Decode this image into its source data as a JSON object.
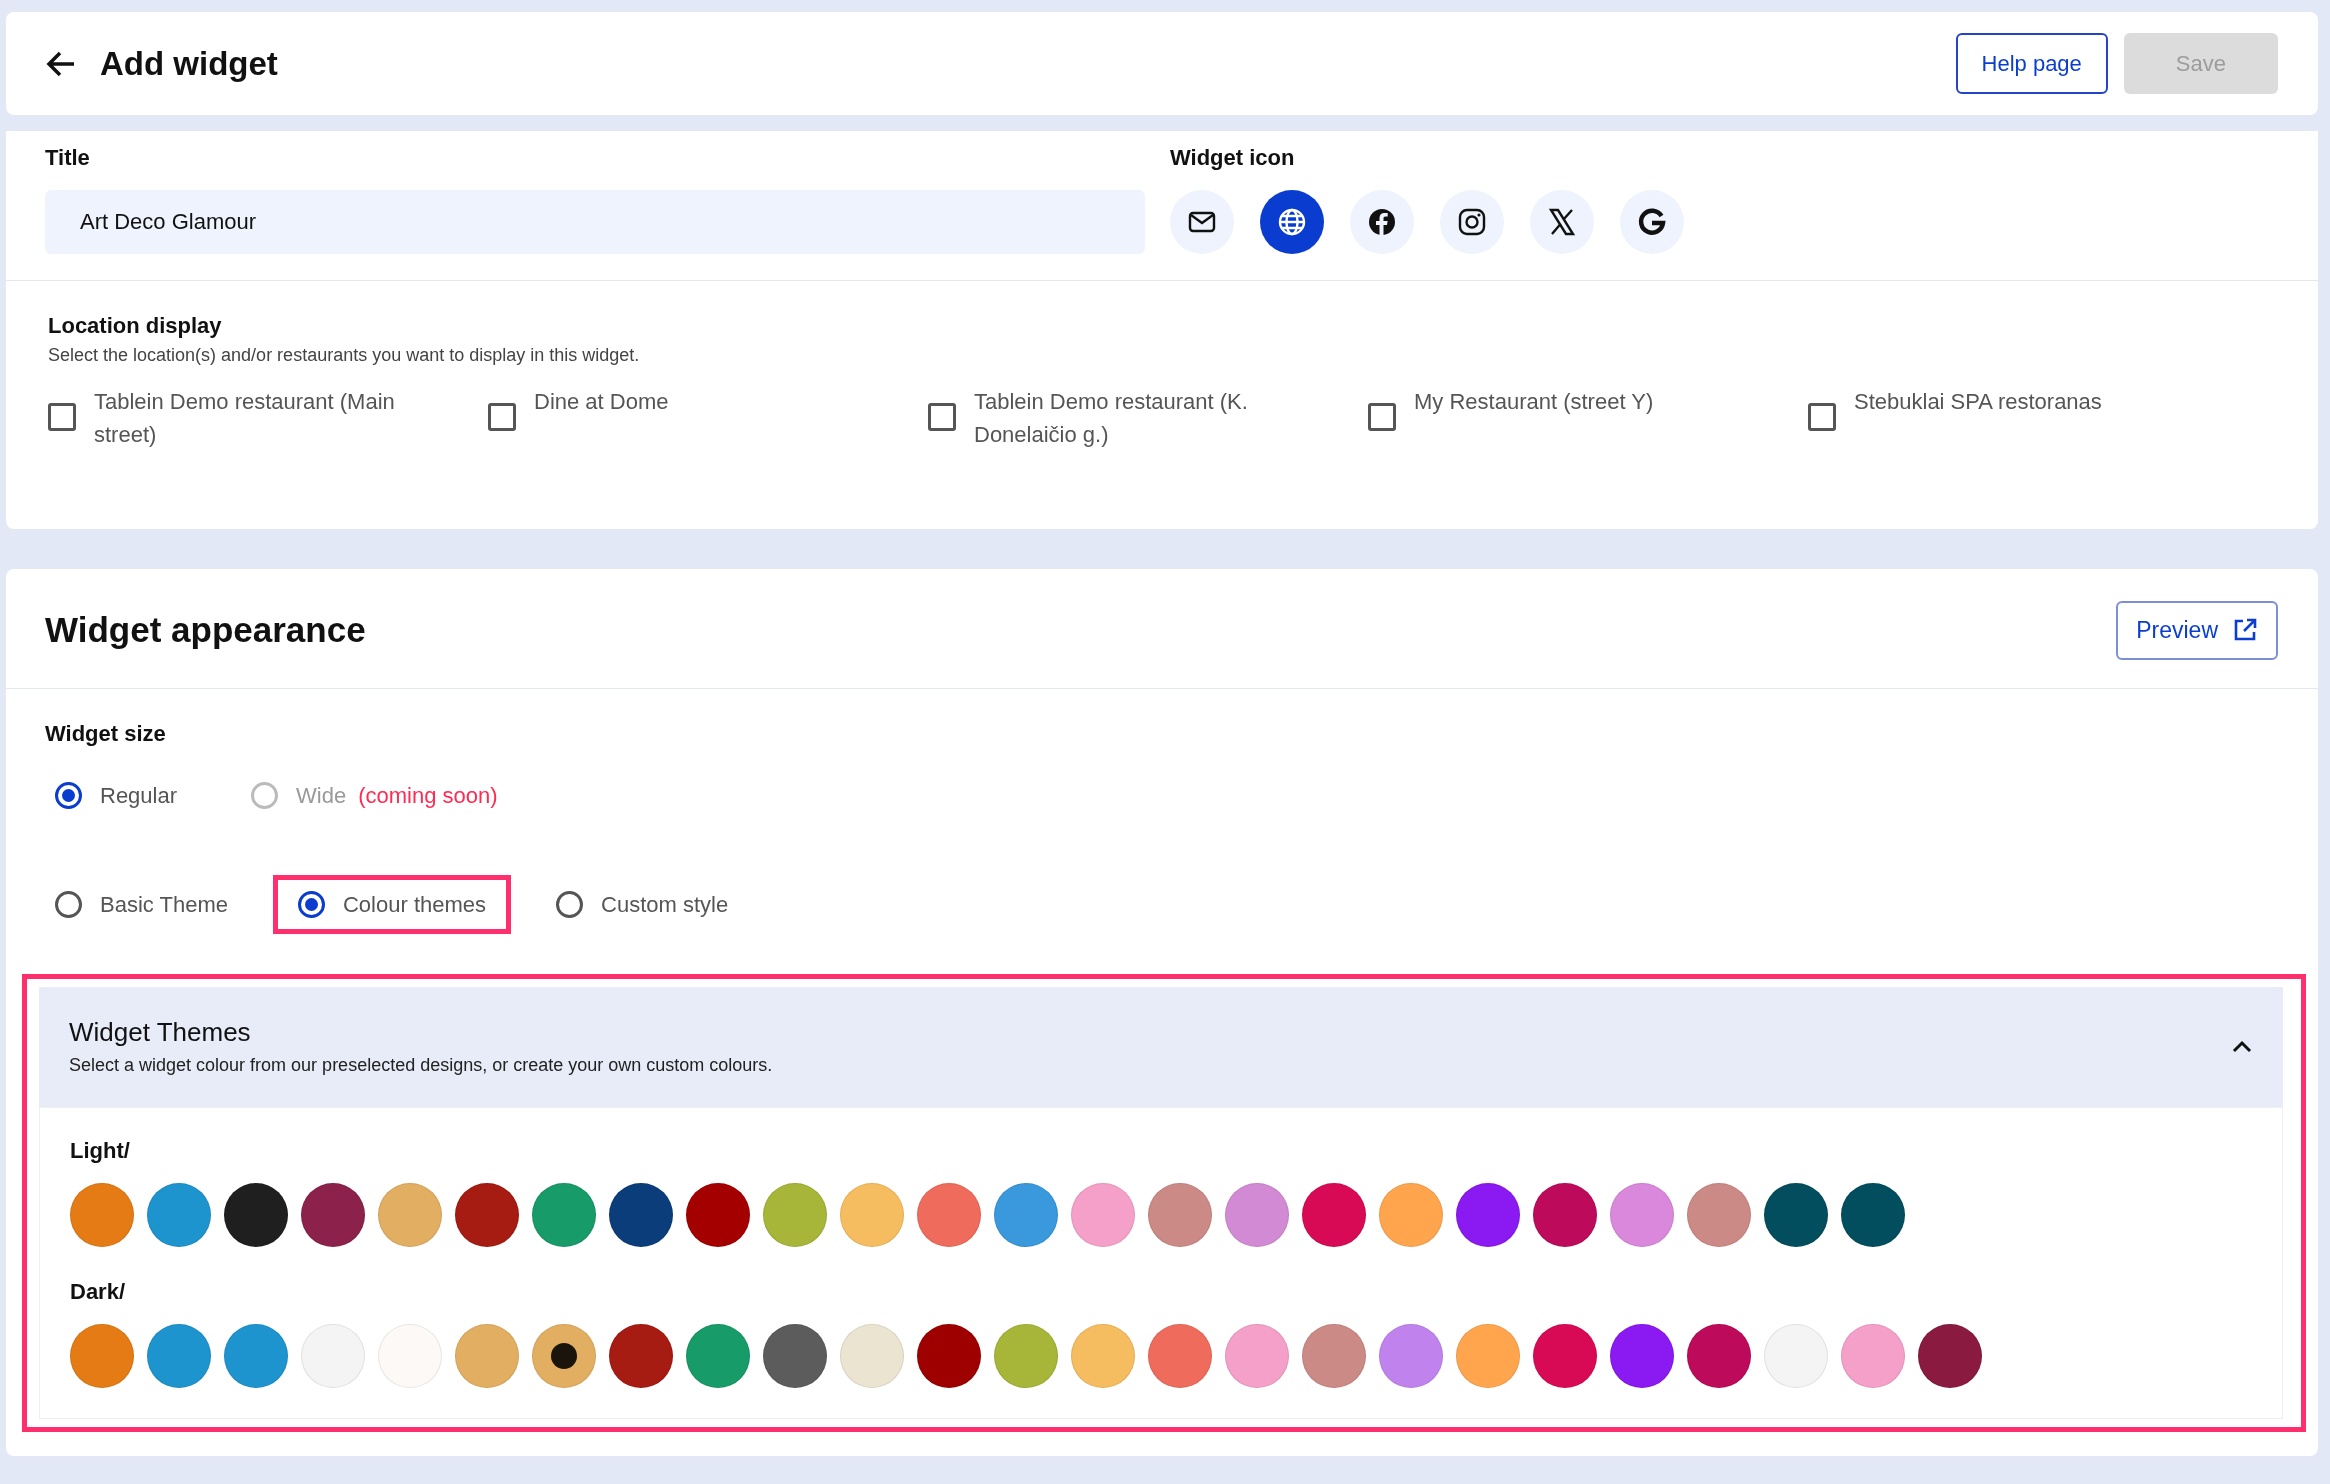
{
  "header": {
    "title": "Add widget",
    "help_button": "Help page",
    "save_button": {
      "label": "Save",
      "disabled": true
    }
  },
  "title_field": {
    "label": "Title",
    "value": "Art Deco Glamour"
  },
  "widget_icon": {
    "label": "Widget icon",
    "options": [
      {
        "kind": "mail",
        "selected": false
      },
      {
        "kind": "globe",
        "selected": true
      },
      {
        "kind": "facebook",
        "selected": false
      },
      {
        "kind": "instagram",
        "selected": false
      },
      {
        "kind": "x",
        "selected": false
      },
      {
        "kind": "google",
        "selected": false
      }
    ]
  },
  "location_display": {
    "label": "Location display",
    "hint": "Select the location(s) and/or restaurants you want to display in this widget.",
    "locations": [
      {
        "label": "Tablein Demo restaurant (Main street)",
        "checked": false
      },
      {
        "label": "Dine at Dome",
        "checked": false
      },
      {
        "label": "Tablein Demo restaurant (K. Donelaičio g.)",
        "checked": false
      },
      {
        "label": "My Restaurant (street Y)",
        "checked": false
      },
      {
        "label": "Stebuklai SPA restoranas",
        "checked": false
      }
    ]
  },
  "appearance": {
    "title": "Widget appearance",
    "preview_button": "Preview",
    "size_label": "Widget size",
    "sizes": [
      {
        "label": "Regular",
        "selected": true,
        "disabled": false
      },
      {
        "label": "Wide",
        "selected": false,
        "disabled": true,
        "note": "(coming soon)"
      }
    ],
    "theme_modes": [
      {
        "label": "Basic Theme",
        "selected": false,
        "highlighted": false
      },
      {
        "label": "Colour themes",
        "selected": true,
        "highlighted": true
      },
      {
        "label": "Custom style",
        "selected": false,
        "highlighted": false
      }
    ],
    "themes_panel": {
      "title": "Widget Themes",
      "subtitle": "Select a widget colour from our preselected designs, or create your own custom colours.",
      "expanded": true,
      "highlighted": true,
      "groups": [
        {
          "label": "Light/",
          "swatches": [
            {
              "color": "#e57b14",
              "selected": false
            },
            {
              "color": "#1e94cf",
              "selected": false
            },
            {
              "color": "#1f1f1f",
              "selected": false
            },
            {
              "color": "#8c214b",
              "selected": false
            },
            {
              "color": "#e2ae62",
              "selected": false
            },
            {
              "color": "#a61b12",
              "selected": false
            },
            {
              "color": "#179b68",
              "selected": false
            },
            {
              "color": "#0a3d7a",
              "selected": false
            },
            {
              "color": "#a50000",
              "selected": false
            },
            {
              "color": "#a7b538",
              "selected": false
            },
            {
              "color": "#f5bd5f",
              "selected": false
            },
            {
              "color": "#ef6b5b",
              "selected": false
            },
            {
              "color": "#3a98dd",
              "selected": false
            },
            {
              "color": "#f4a0c8",
              "selected": false
            },
            {
              "color": "#cc8a86",
              "selected": false
            },
            {
              "color": "#d38ad4",
              "selected": false
            },
            {
              "color": "#d90a55",
              "selected": false
            },
            {
              "color": "#fea54e",
              "selected": false
            },
            {
              "color": "#8a19f2",
              "selected": false
            },
            {
              "color": "#bd0a5a",
              "selected": false
            },
            {
              "color": "#d988dc",
              "selected": false
            },
            {
              "color": "#cc8a86",
              "selected": false
            },
            {
              "color": "#034e5e",
              "selected": false
            },
            {
              "color": "#034e5e",
              "selected": false
            }
          ]
        },
        {
          "label": "Dark/",
          "swatches": [
            {
              "color": "#e57b14",
              "selected": false
            },
            {
              "color": "#1e94cf",
              "selected": false
            },
            {
              "color": "#1e94cf",
              "selected": false
            },
            {
              "color": "#f4f4f4",
              "selected": false
            },
            {
              "color": "#fcf9f6",
              "selected": false
            },
            {
              "color": "#e2ae62",
              "selected": false
            },
            {
              "color": "#e2ae62",
              "selected": true
            },
            {
              "color": "#a61b12",
              "selected": false
            },
            {
              "color": "#179b68",
              "selected": false
            },
            {
              "color": "#5c5c5c",
              "selected": false
            },
            {
              "color": "#ebe4d1",
              "selected": false
            },
            {
              "color": "#9e0000",
              "selected": false
            },
            {
              "color": "#a7b538",
              "selected": false
            },
            {
              "color": "#f5bd5f",
              "selected": false
            },
            {
              "color": "#ef6b5b",
              "selected": false
            },
            {
              "color": "#f4a0c8",
              "selected": false
            },
            {
              "color": "#cc8a86",
              "selected": false
            },
            {
              "color": "#c083ee",
              "selected": false
            },
            {
              "color": "#fea54e",
              "selected": false
            },
            {
              "color": "#d90a55",
              "selected": false
            },
            {
              "color": "#8a19f2",
              "selected": false
            },
            {
              "color": "#bd0a5a",
              "selected": false
            },
            {
              "color": "#f4f4f4",
              "selected": false
            },
            {
              "color": "#f4a0c8",
              "selected": false
            },
            {
              "color": "#8a1a40",
              "selected": false
            }
          ]
        }
      ]
    }
  }
}
